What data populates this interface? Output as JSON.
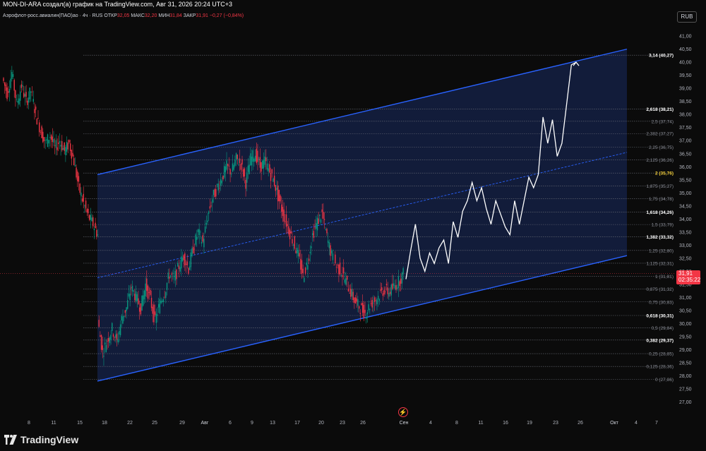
{
  "header": {
    "author_line": "MON-DI-ARA создал(а) график на TradingView.com, Авг 31, 2026 20:24 UTC+3",
    "symbol": "Аэрофлот-росс.авиалин(ПАО)ао · 4ч · RUS",
    "open_label": "ОТКР",
    "open_value": "32,05",
    "high_label": "МАКС",
    "high_value": "32,20",
    "low_label": "МИН",
    "low_value": "31,84",
    "close_label": "ЗАКР",
    "close_value": "31,91",
    "change": "−0,27 (−0,84%)"
  },
  "currency": "RUB",
  "last_price": {
    "value": "31,91",
    "countdown": "02:35:22"
  },
  "brand": "TradingView",
  "colors": {
    "up": "#089981",
    "down": "#f23645",
    "channel_line": "#2962ff",
    "channel_fill": "#131e3d",
    "projection": "#ffffff",
    "highlight_level": "#f7d23b"
  },
  "chart_data": {
    "type": "candlestick",
    "ylim": [
      26.8,
      41.3
    ],
    "y_ticks": [
      "41,00",
      "40,50",
      "40,00",
      "39,50",
      "39,00",
      "38,50",
      "38,00",
      "37,50",
      "37,00",
      "36,50",
      "36,00",
      "35,50",
      "35,00",
      "34,50",
      "34,00",
      "33,50",
      "33,00",
      "32,50",
      "32,00",
      "31,50",
      "31,00",
      "30,50",
      "30,00",
      "29,50",
      "29,00",
      "28,50",
      "28,00",
      "27,50",
      "27,00"
    ],
    "x_ticks": [
      "8",
      "11",
      "15",
      "18",
      "22",
      "25",
      "29",
      "Авг",
      "6",
      "9",
      "13",
      "17",
      "20",
      "23",
      "26",
      "Сен",
      "4",
      "8",
      "11",
      "16",
      "19",
      "23",
      "26",
      "Окт",
      "4",
      "7"
    ],
    "close_path": [
      [
        0,
        39.4
      ],
      [
        4,
        38.8
      ],
      [
        8,
        39.6
      ],
      [
        12,
        38.4
      ],
      [
        16,
        39.1
      ],
      [
        20,
        38.5
      ],
      [
        24,
        38.9
      ],
      [
        28,
        38.0
      ],
      [
        32,
        37.4
      ],
      [
        36,
        36.9
      ],
      [
        40,
        37.2
      ],
      [
        44,
        36.7
      ],
      [
        48,
        37.0
      ],
      [
        52,
        36.6
      ],
      [
        56,
        36.9
      ],
      [
        60,
        36.2
      ],
      [
        64,
        35.2
      ],
      [
        68,
        34.6
      ],
      [
        72,
        34.1
      ],
      [
        76,
        33.8
      ],
      [
        80,
        33.4
      ],
      [
        80,
        30.1
      ],
      [
        84,
        28.9
      ],
      [
        88,
        29.4
      ],
      [
        92,
        29.8
      ],
      [
        96,
        29.3
      ],
      [
        100,
        30.2
      ],
      [
        104,
        30.6
      ],
      [
        108,
        31.4
      ],
      [
        112,
        31.0
      ],
      [
        116,
        30.6
      ],
      [
        120,
        31.5
      ],
      [
        124,
        30.9
      ],
      [
        128,
        30.1
      ],
      [
        132,
        30.8
      ],
      [
        136,
        31.2
      ],
      [
        140,
        31.9
      ],
      [
        144,
        31.7
      ],
      [
        148,
        32.2
      ],
      [
        152,
        32.6
      ],
      [
        156,
        32.1
      ],
      [
        160,
        32.9
      ],
      [
        164,
        33.5
      ],
      [
        168,
        33.1
      ],
      [
        172,
        34.1
      ],
      [
        176,
        34.8
      ],
      [
        180,
        35.2
      ],
      [
        184,
        35.6
      ],
      [
        188,
        36.0
      ],
      [
        192,
        35.8
      ],
      [
        196,
        36.3
      ],
      [
        200,
        36.1
      ],
      [
        204,
        35.4
      ],
      [
        208,
        36.3
      ],
      [
        212,
        36.5
      ],
      [
        216,
        36.0
      ],
      [
        220,
        36.2
      ],
      [
        224,
        35.8
      ],
      [
        228,
        35.4
      ],
      [
        232,
        34.7
      ],
      [
        236,
        34.1
      ],
      [
        240,
        33.6
      ],
      [
        244,
        33.1
      ],
      [
        248,
        32.6
      ],
      [
        252,
        31.8
      ],
      [
        256,
        32.4
      ],
      [
        260,
        33.4
      ],
      [
        264,
        33.9
      ],
      [
        268,
        34.2
      ],
      [
        272,
        33.3
      ],
      [
        276,
        32.6
      ],
      [
        280,
        32.2
      ],
      [
        284,
        32.0
      ],
      [
        288,
        31.6
      ],
      [
        292,
        31.2
      ],
      [
        296,
        30.8
      ],
      [
        300,
        30.6
      ],
      [
        304,
        30.4
      ],
      [
        308,
        30.7
      ],
      [
        312,
        30.9
      ],
      [
        316,
        31.1
      ],
      [
        320,
        31.3
      ],
      [
        324,
        31.2
      ],
      [
        328,
        31.4
      ],
      [
        332,
        31.6
      ],
      [
        336,
        31.91
      ]
    ],
    "projection": [
      [
        31.7
      ],
      [
        32.8
      ],
      [
        33.8
      ],
      [
        32.5
      ],
      [
        32.0
      ],
      [
        32.7
      ],
      [
        32.3
      ],
      [
        32.9
      ],
      [
        33.2
      ],
      [
        32.3
      ],
      [
        33.9
      ],
      [
        33.3
      ],
      [
        34.3
      ],
      [
        34.7
      ],
      [
        35.4
      ],
      [
        34.7
      ],
      [
        35.2
      ],
      [
        34.4
      ],
      [
        33.8
      ],
      [
        34.7
      ],
      [
        34.2
      ],
      [
        33.7
      ],
      [
        33.4
      ],
      [
        34.7
      ],
      [
        33.8
      ],
      [
        34.7
      ],
      [
        35.6
      ],
      [
        35.2
      ],
      [
        35.7
      ],
      [
        37.9
      ],
      [
        36.9
      ],
      [
        37.8
      ],
      [
        36.4
      ],
      [
        36.9
      ],
      [
        38.4
      ],
      [
        39.9
      ],
      [
        40.0
      ]
    ],
    "channel": {
      "upper": [
        [
          0,
          35.7
        ],
        [
          1,
          40.5
        ]
      ],
      "lower": [
        [
          0,
          27.8
        ],
        [
          1,
          32.6
        ]
      ],
      "mid": [
        [
          0,
          31.75
        ],
        [
          1,
          36.55
        ]
      ]
    },
    "fib_levels": [
      {
        "label": "0 (27,86)",
        "value": 27.86
      },
      {
        "label": "0,125 (28,36)",
        "value": 28.36
      },
      {
        "label": "0,25 (28,85)",
        "value": 28.85
      },
      {
        "label": "0,382 (29,37)",
        "value": 29.37
      },
      {
        "label": "0,5 (29,84)",
        "value": 29.84
      },
      {
        "label": "0,618 (30,31)",
        "value": 30.31
      },
      {
        "label": "0,75 (30,83)",
        "value": 30.83
      },
      {
        "label": "0,875 (31,32)",
        "value": 31.32
      },
      {
        "label": "1 (31,81)",
        "value": 31.81
      },
      {
        "label": "1,125 (32,31)",
        "value": 32.31
      },
      {
        "label": "1,25 (32,80)",
        "value": 32.8
      },
      {
        "label": "1,382 (33,32)",
        "value": 33.32
      },
      {
        "label": "1,5 (33,79)",
        "value": 33.79
      },
      {
        "label": "1,618 (34,26)",
        "value": 34.26
      },
      {
        "label": "1,75 (34,78)",
        "value": 34.78
      },
      {
        "label": "1,875 (35,27)",
        "value": 35.27
      },
      {
        "label": "2 (35,76)",
        "value": 35.76
      },
      {
        "label": "2,125 (36,26)",
        "value": 36.26
      },
      {
        "label": "2,25 (36,75)",
        "value": 36.75
      },
      {
        "label": "2,382 (37,27)",
        "value": 37.27
      },
      {
        "label": "2,5 (37,74)",
        "value": 37.74
      },
      {
        "label": "2,618 (38,21)",
        "value": 38.21
      },
      {
        "label": "3,14 (40,27)",
        "value": 40.27
      }
    ]
  }
}
